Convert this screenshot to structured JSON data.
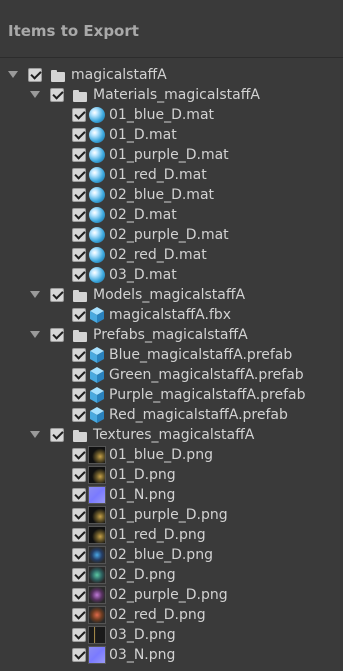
{
  "header": {
    "title": "Items to Export"
  },
  "tree": [
    {
      "label": "magicalstaffA",
      "type": "folder",
      "level": 0
    },
    {
      "label": "Materials_magicalstaffA",
      "type": "folder",
      "level": 1
    },
    {
      "label": "01_blue_D.mat",
      "type": "mat",
      "level": 2
    },
    {
      "label": "01_D.mat",
      "type": "mat",
      "level": 2
    },
    {
      "label": "01_purple_D.mat",
      "type": "mat",
      "level": 2
    },
    {
      "label": "01_red_D.mat",
      "type": "mat",
      "level": 2
    },
    {
      "label": "02_blue_D.mat",
      "type": "mat",
      "level": 2
    },
    {
      "label": "02_D.mat",
      "type": "mat",
      "level": 2
    },
    {
      "label": "02_purple_D.mat",
      "type": "mat",
      "level": 2
    },
    {
      "label": "02_red_D.mat",
      "type": "mat",
      "level": 2
    },
    {
      "label": "03_D.mat",
      "type": "mat",
      "level": 2
    },
    {
      "label": "Models_magicalstaffA",
      "type": "folder",
      "level": 1
    },
    {
      "label": "magicalstaffA.fbx",
      "type": "model",
      "level": 2
    },
    {
      "label": "Prefabs_magicalstaffA",
      "type": "folder",
      "level": 1
    },
    {
      "label": "Blue_magicalstaffA.prefab",
      "type": "prefab",
      "level": 2
    },
    {
      "label": "Green_magicalstaffA.prefab",
      "type": "prefab",
      "level": 2
    },
    {
      "label": "Purple_magicalstaffA.prefab",
      "type": "prefab",
      "level": 2
    },
    {
      "label": "Red_magicalstaffA.prefab",
      "type": "prefab",
      "level": 2
    },
    {
      "label": "Textures_magicalstaffA",
      "type": "folder",
      "level": 1
    },
    {
      "label": "01_blue_D.png",
      "type": "texture",
      "level": 2,
      "swatch": "dark-gold"
    },
    {
      "label": "01_D.png",
      "type": "texture",
      "level": 2,
      "swatch": "dark-gold"
    },
    {
      "label": "01_N.png",
      "type": "texture",
      "level": 2,
      "swatch": "normal"
    },
    {
      "label": "01_purple_D.png",
      "type": "texture",
      "level": 2,
      "swatch": "dark-gold"
    },
    {
      "label": "01_red_D.png",
      "type": "texture",
      "level": 2,
      "swatch": "dark-gold"
    },
    {
      "label": "02_blue_D.png",
      "type": "texture",
      "level": 2,
      "swatch": "orb-blue"
    },
    {
      "label": "02_D.png",
      "type": "texture",
      "level": 2,
      "swatch": "orb-green"
    },
    {
      "label": "02_purple_D.png",
      "type": "texture",
      "level": 2,
      "swatch": "orb-purple"
    },
    {
      "label": "02_red_D.png",
      "type": "texture",
      "level": 2,
      "swatch": "orb-red"
    },
    {
      "label": "03_D.png",
      "type": "texture",
      "level": 2,
      "swatch": "staff"
    },
    {
      "label": "03_N.png",
      "type": "texture",
      "level": 2,
      "swatch": "normal"
    }
  ]
}
